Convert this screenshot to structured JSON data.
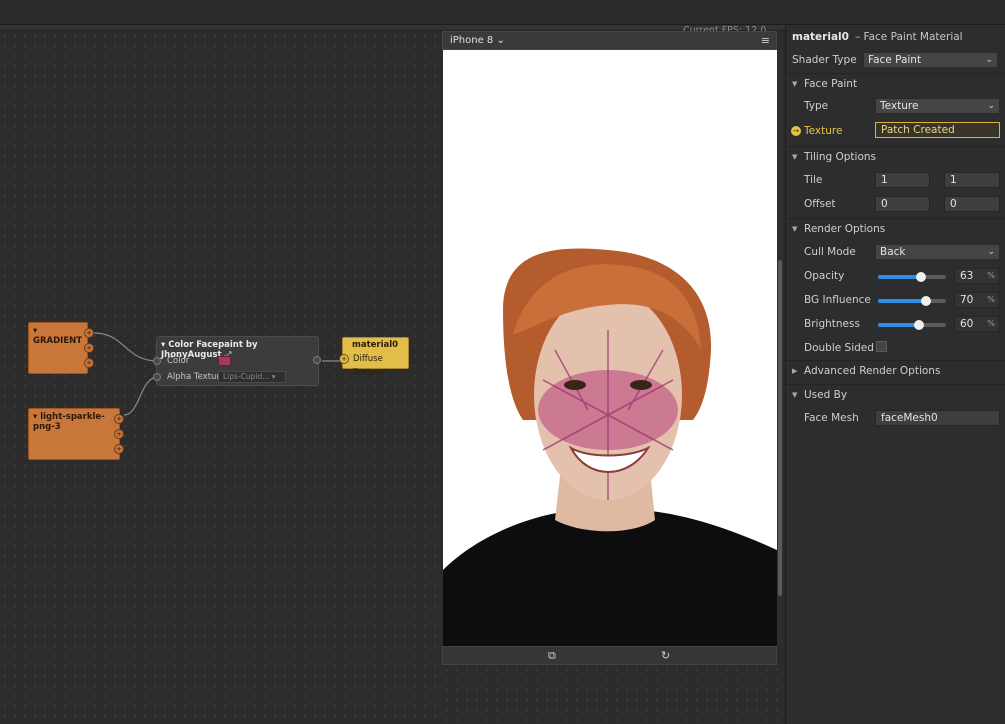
{
  "topbar": {
    "fps_text": "Current FPS: 12.0"
  },
  "patch_editor": {
    "nodes": {
      "gradient": {
        "label": "GRADIENT"
      },
      "sparkle": {
        "label": "light-sparkle-png-3"
      },
      "facepaint": {
        "title": "Color Facepaint by JhonyAugust",
        "inputs": [
          {
            "label": "Color"
          },
          {
            "label": "Alpha Texture",
            "value": "Lips-Cupid..."
          }
        ],
        "swatch_color": "#a33a5e"
      },
      "material": {
        "title": "material0",
        "input_label": "Diffuse Texture"
      }
    }
  },
  "simulator": {
    "device": "iPhone 8",
    "menu_icon": "hamburger-icon",
    "footer_icons": [
      "capture-icon",
      "rotate-icon"
    ]
  },
  "inspector": {
    "title": "material0",
    "subtitle": "– Face Paint Material",
    "shader_type": {
      "label": "Shader Type",
      "value": "Face Paint"
    },
    "face_paint": {
      "section": "Face Paint",
      "type_label": "Type",
      "type_value": "Texture",
      "texture_label": "Texture",
      "texture_value": "Patch Created"
    },
    "tiling": {
      "section": "Tiling Options",
      "tile_label": "Tile",
      "tile_x": "1",
      "tile_y": "1",
      "offset_label": "Offset",
      "offset_x": "0",
      "offset_y": "0"
    },
    "render": {
      "section": "Render Options",
      "cull_label": "Cull Mode",
      "cull_value": "Back",
      "opacity_label": "Opacity",
      "opacity_value": "63",
      "opacity_unit": "%",
      "bg_label": "BG Influence",
      "bg_value": "70",
      "bg_unit": "%",
      "brightness_label": "Brightness",
      "brightness_value": "60",
      "brightness_unit": "%",
      "double_label": "Double Sided"
    },
    "advanced": {
      "section": "Advanced Render Options"
    },
    "used_by": {
      "section": "Used By",
      "mesh_label": "Face Mesh",
      "mesh_value": "faceMesh0"
    },
    "accent_color": "#2d8ee6",
    "highlight_color": "#d6b43e"
  }
}
